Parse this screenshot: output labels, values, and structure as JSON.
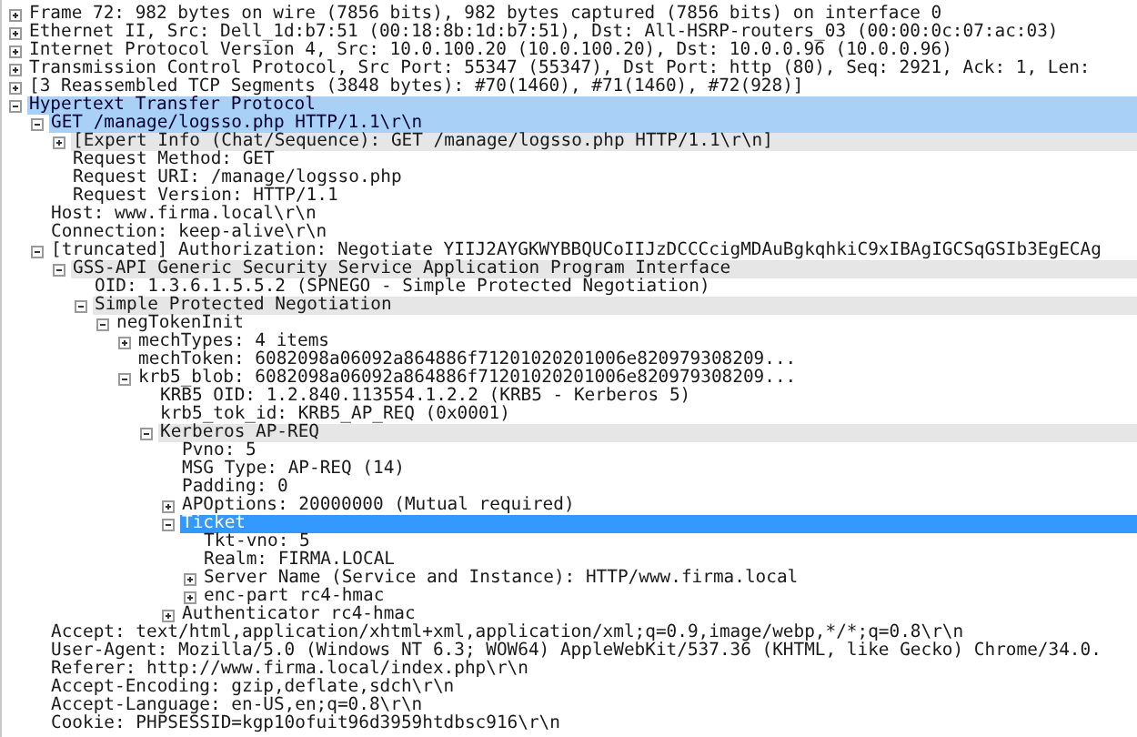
{
  "tree": [
    {
      "label": "Frame 72: 982 bytes on wire (7856 bits), 982 bytes captured (7856 bits) on interface 0",
      "expanded": false,
      "selected": false
    },
    {
      "label": "Ethernet II, Src: Dell_1d:b7:51 (00:18:8b:1d:b7:51), Dst: All-HSRP-routers_03 (00:00:0c:07:ac:03)",
      "expanded": false,
      "selected": false
    },
    {
      "label": "Internet Protocol Version 4, Src: 10.0.100.20 (10.0.100.20), Dst: 10.0.0.96 (10.0.0.96)",
      "expanded": false,
      "selected": false
    },
    {
      "label": "Transmission Control Protocol, Src Port: 55347 (55347), Dst Port: http (80), Seq: 2921, Ack: 1, Len:",
      "expanded": false,
      "selected": false
    },
    {
      "label": "[3 Reassembled TCP Segments (3848 bytes): #70(1460), #71(1460), #72(928)]",
      "expanded": false,
      "selected": false
    },
    {
      "label": "Hypertext Transfer Protocol",
      "expanded": true,
      "selected": false,
      "branch_highlight": true,
      "children": [
        {
          "label": "GET /manage/logsso.php HTTP/1.1\\r\\n",
          "expanded": true,
          "selected": false,
          "branch_highlight": true,
          "children": [
            {
              "label": "[Expert Info (Chat/Sequence): GET /manage/logsso.php HTTP/1.1\\r\\n]",
              "expanded": false,
              "selected": false,
              "shaded": true
            },
            {
              "label": "Request Method: GET",
              "selected": false
            },
            {
              "label": "Request URI: /manage/logsso.php",
              "selected": false
            },
            {
              "label": "Request Version: HTTP/1.1",
              "selected": false
            }
          ]
        },
        {
          "label": "Host: www.firma.local\\r\\n",
          "selected": false
        },
        {
          "label": "Connection: keep-alive\\r\\n",
          "selected": false
        },
        {
          "label": "[truncated] Authorization: Negotiate YIIJ2AYGKWYBBQUCoIIJzDCCCcigMDAuBgkqhkiC9xIBAgIGCSqGSIb3EgECAg",
          "expanded": true,
          "selected": false,
          "children": [
            {
              "label": "GSS-API Generic Security Service Application Program Interface",
              "expanded": true,
              "selected": false,
              "shaded": true,
              "children": [
                {
                  "label": "OID: 1.3.6.1.5.5.2 (SPNEGO - Simple Protected Negotiation)",
                  "selected": false
                },
                {
                  "label": "Simple Protected Negotiation",
                  "expanded": true,
                  "selected": false,
                  "shaded": true,
                  "children": [
                    {
                      "label": "negTokenInit",
                      "expanded": true,
                      "selected": false,
                      "children": [
                        {
                          "label": "mechTypes: 4 items",
                          "expanded": false,
                          "selected": false
                        },
                        {
                          "label": "mechToken: 6082098a06092a864886f71201020201006e820979308209...",
                          "selected": false
                        },
                        {
                          "label": "krb5_blob: 6082098a06092a864886f71201020201006e820979308209...",
                          "expanded": true,
                          "selected": false,
                          "children": [
                            {
                              "label": "KRB5 OID: 1.2.840.113554.1.2.2 (KRB5 - Kerberos 5)",
                              "selected": false
                            },
                            {
                              "label": "krb5_tok_id: KRB5_AP_REQ (0x0001)",
                              "selected": false
                            },
                            {
                              "label": "Kerberos AP-REQ",
                              "expanded": true,
                              "selected": false,
                              "shaded": true,
                              "children": [
                                {
                                  "label": "Pvno: 5",
                                  "selected": false
                                },
                                {
                                  "label": "MSG Type: AP-REQ (14)",
                                  "selected": false
                                },
                                {
                                  "label": "Padding: 0",
                                  "selected": false
                                },
                                {
                                  "label": "APOptions: 20000000 (Mutual required)",
                                  "expanded": false,
                                  "selected": false
                                },
                                {
                                  "label": "Ticket",
                                  "expanded": true,
                                  "selected": true,
                                  "children": [
                                    {
                                      "label": "Tkt-vno: 5",
                                      "selected": false
                                    },
                                    {
                                      "label": "Realm: FIRMA.LOCAL",
                                      "selected": false
                                    },
                                    {
                                      "label": "Server Name (Service and Instance): HTTP/www.firma.local",
                                      "expanded": false,
                                      "selected": false
                                    },
                                    {
                                      "label": "enc-part rc4-hmac",
                                      "expanded": false,
                                      "selected": false
                                    }
                                  ]
                                },
                                {
                                  "label": "Authenticator rc4-hmac",
                                  "expanded": false,
                                  "selected": false
                                }
                              ]
                            }
                          ]
                        }
                      ]
                    }
                  ]
                }
              ]
            }
          ]
        },
        {
          "label": "Accept: text/html,application/xhtml+xml,application/xml;q=0.9,image/webp,*/*;q=0.8\\r\\n",
          "selected": false
        },
        {
          "label": "User-Agent: Mozilla/5.0 (Windows NT 6.3; WOW64) AppleWebKit/537.36 (KHTML, like Gecko) Chrome/34.0.",
          "selected": false
        },
        {
          "label": "Referer: http://www.firma.local/index.php\\r\\n",
          "selected": false
        },
        {
          "label": "Accept-Encoding: gzip,deflate,sdch\\r\\n",
          "selected": false
        },
        {
          "label": "Accept-Language: en-US,en;q=0.8\\r\\n",
          "selected": false
        },
        {
          "label": "Cookie: PHPSESSID=kgp10ofuit96d3959htdbsc916\\r\\n",
          "selected": false
        }
      ]
    }
  ]
}
